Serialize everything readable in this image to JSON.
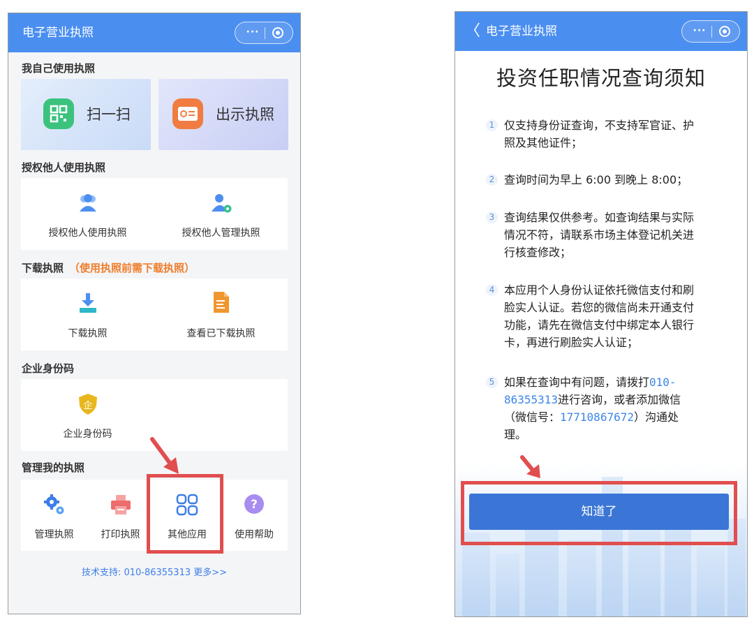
{
  "left": {
    "nav_title": "电子营业执照",
    "capsule_more": "···",
    "sections": {
      "self": "我自己使用执照",
      "authorize": "授权他人使用执照",
      "download": "下载执照",
      "download_note": "（使用执照前需下载执照）",
      "enterprise_code": "企业身份码",
      "manage": "管理我的执照"
    },
    "self_tiles": {
      "scan": "扫一扫",
      "show": "出示执照"
    },
    "authorize_items": [
      "授权他人使用执照",
      "授权他人管理执照"
    ],
    "download_items": [
      "下载执照",
      "查看已下载执照"
    ],
    "enterprise_item": "企业身份码",
    "manage_items": [
      "管理执照",
      "打印执照",
      "其他应用",
      "使用帮助"
    ],
    "footer": "技术支持: 010-86355313  更多>>"
  },
  "right": {
    "nav_back": "〈",
    "nav_title": "电子营业执照",
    "capsule_more": "···",
    "title": "投资任职情况查询须知",
    "rules": [
      {
        "num": "1",
        "lines": [
          "仅支持身份证查询，不支持军官证、护",
          "照及其他证件；"
        ]
      },
      {
        "num": "2",
        "lines": [
          "查询时间为早上 6:00 到晚上 8:00；"
        ]
      },
      {
        "num": "3",
        "lines": [
          "查询结果仅供参考。如查询结果与实际",
          "情况不符，请联系市场主体登记机关进",
          "行核查修改；"
        ]
      },
      {
        "num": "4",
        "lines": [
          "本应用个人身份认证依托微信支付和刷",
          "脸实人认证。若您的微信尚未开通支付",
          "功能，请先在微信支付中绑定本人银行",
          "卡，再进行刷脸实人认证；"
        ]
      }
    ],
    "rule5": {
      "num": "5",
      "pre": "如果在查询中有问题，请拨打",
      "phone_a": "010-",
      "phone_b": "86355313",
      "mid": "进行咨询，或者添加微信",
      "wechat_pre": "（微信号：",
      "wechat": "17710867672",
      "wechat_post": "）沟通处",
      "end": "理。"
    },
    "ok_button": "知道了"
  },
  "colors": {
    "navbar": "#4a8ef0",
    "highlight": "#e14e4e",
    "link": "#3c7ee8",
    "note": "#ef7d2b",
    "button": "#3b76d6"
  }
}
